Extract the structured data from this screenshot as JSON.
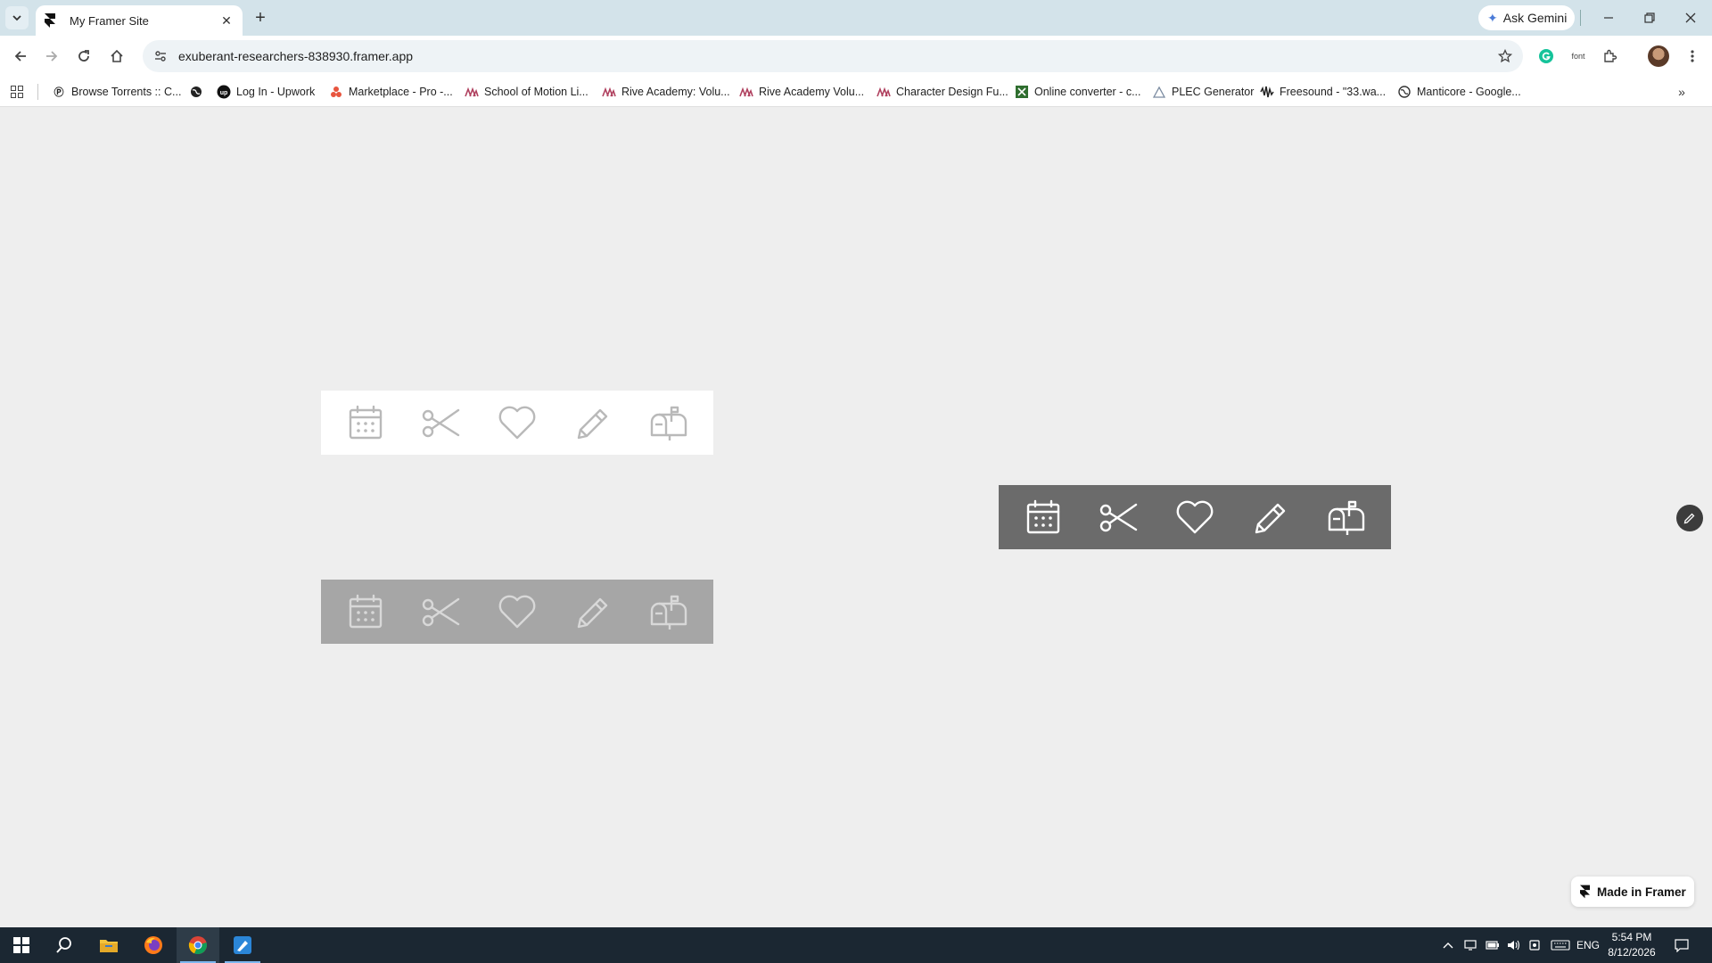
{
  "browser": {
    "tab": {
      "title": "My Framer Site"
    },
    "gemini_label": "Ask Gemini",
    "url": "exuberant-researchers-838930.framer.app",
    "extension_label": "font"
  },
  "bookmarks": [
    {
      "label": "Browse Torrents :: C...",
      "icon": "torrent-icon"
    },
    {
      "label": "",
      "icon": "globe-icon"
    },
    {
      "label": "Log In - Upwork",
      "icon": "upwork-icon"
    },
    {
      "label": "Marketplace - Pro -...",
      "icon": "marketplace-icon"
    },
    {
      "label": "School of Motion Li...",
      "icon": "rive-icon"
    },
    {
      "label": "Rive Academy: Volu...",
      "icon": "rive-icon"
    },
    {
      "label": "Rive Academy Volu...",
      "icon": "rive-icon"
    },
    {
      "label": "Character Design Fu...",
      "icon": "rive-icon"
    },
    {
      "label": "Online converter - c...",
      "icon": "converter-icon"
    },
    {
      "label": "PLEC Generator",
      "icon": "plec-icon"
    },
    {
      "label": "Freesound - \"33.wa...",
      "icon": "freesound-icon"
    },
    {
      "label": "Manticore - Google...",
      "icon": "globe-icon"
    }
  ],
  "page": {
    "icon_bars": [
      {
        "variant": "light",
        "background": "#ffffff",
        "icon_color": "#b9b9b9",
        "icons": [
          "calendar-icon",
          "scissors-icon",
          "heart-icon",
          "pencil-icon",
          "mailbox-icon"
        ]
      },
      {
        "variant": "mid",
        "background": "#a6a6a6",
        "icon_color": "#d8d8d8",
        "icons": [
          "calendar-icon",
          "scissors-icon",
          "heart-icon",
          "pencil-icon",
          "mailbox-icon"
        ]
      },
      {
        "variant": "dark",
        "background": "#6b6b6b",
        "icon_color": "#ffffff",
        "icons": [
          "calendar-icon",
          "scissors-icon",
          "heart-icon",
          "pencil-icon",
          "mailbox-icon"
        ]
      }
    ],
    "badge_label": "Made in Framer"
  },
  "taskbar": {
    "apps": [
      "start-icon",
      "search-icon",
      "file-explorer-icon",
      "firefox-icon",
      "chrome-icon",
      "pen-app-icon"
    ],
    "language": "ENG",
    "time": "5:54 PM",
    "date": "8/12/2026"
  }
}
